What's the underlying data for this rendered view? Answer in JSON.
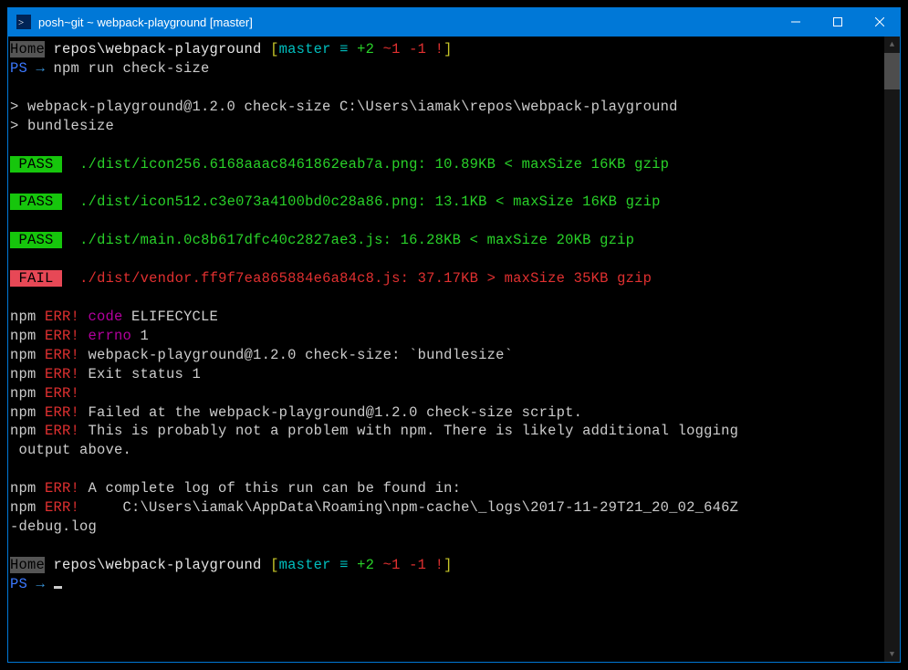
{
  "titlebar": {
    "title": "posh~git ~ webpack-playground [master]"
  },
  "prompt1": {
    "home": "Home",
    "path": " repos\\webpack-playground ",
    "bracket_open": "[",
    "branch": "master",
    "equiv": " ≡ ",
    "ahead": "+2",
    "mod": " ~1",
    "del": " -1",
    "bang": " !",
    "bracket_close": "]"
  },
  "ps": {
    "label": "PS ",
    "arrow": "→",
    "cmd": " npm run check-size"
  },
  "npm_header": {
    "line1": "> webpack-playground@1.2.0 check-size C:\\Users\\iamak\\repos\\webpack-playground",
    "line2": "> bundlesize"
  },
  "results": [
    {
      "status": "PASS",
      "text": "./dist/icon256.6168aaac8461862eab7a.png: 10.89KB < maxSize 16KB gzip"
    },
    {
      "status": "PASS",
      "text": "./dist/icon512.c3e073a4100bd0c28a86.png: 13.1KB < maxSize 16KB gzip"
    },
    {
      "status": "PASS",
      "text": "./dist/main.0c8b617dfc40c2827ae3.js: 16.28KB < maxSize 20KB gzip"
    },
    {
      "status": "FAIL",
      "text": "./dist/vendor.ff9f7ea865884e6a84c8.js: 37.17KB > maxSize 35KB gzip"
    }
  ],
  "err": {
    "npm": "npm",
    "err": " ERR!",
    "code_lbl": " code",
    "code_val": " ELIFECYCLE",
    "errno_lbl": " errno",
    "errno_val": " 1",
    "l3": " webpack-playground@1.2.0 check-size: `bundlesize`",
    "l4": " Exit status 1",
    "l6": " Failed at the webpack-playground@1.2.0 check-size script.",
    "l7a": " This is probably not a problem with npm. There is likely additional logging",
    "l7b": " output above.",
    "l9": " A complete log of this run can be found in:",
    "l10a": "     C:\\Users\\iamak\\AppData\\Roaming\\npm-cache\\_logs\\2017-11-29T21_20_02_646Z",
    "l10b": "-debug.log"
  },
  "prompt2": {
    "home": "Home",
    "path": " repos\\webpack-playground ",
    "bracket_open": "[",
    "branch": "master",
    "equiv": " ≡ ",
    "ahead": "+2",
    "mod": " ~1",
    "del": " -1",
    "bang": " !",
    "bracket_close": "]"
  },
  "ps2": {
    "label": "PS ",
    "arrow": "→ "
  }
}
